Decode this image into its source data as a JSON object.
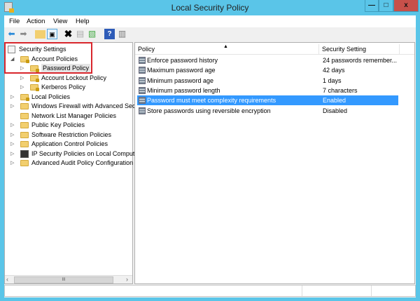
{
  "window": {
    "title": "Local Security Policy",
    "minimize": "—",
    "maximize": "□",
    "close": "x"
  },
  "menu": [
    "File",
    "Action",
    "View",
    "Help"
  ],
  "toolbar": [
    "back-icon",
    "forward-icon",
    "up-folder-icon",
    "show-hide-tree-icon",
    "delete-icon",
    "properties-icon",
    "export-list-icon",
    "help-icon",
    "show-action-pane-icon"
  ],
  "tree": [
    {
      "label": "Security Settings",
      "level": 0,
      "expander": "",
      "icon": "security-settings-icon"
    },
    {
      "label": "Account Policies",
      "level": 1,
      "expander": "◢",
      "icon": "folder-lock-icon"
    },
    {
      "label": "Password Policy",
      "level": 2,
      "expander": "▷",
      "icon": "folder-lock-icon",
      "selected": true
    },
    {
      "label": "Account Lockout Policy",
      "level": 2,
      "expander": "▷",
      "icon": "folder-lock-icon"
    },
    {
      "label": "Kerberos Policy",
      "level": 2,
      "expander": "▷",
      "icon": "folder-lock-icon"
    },
    {
      "label": "Local Policies",
      "level": 1,
      "expander": "▷",
      "icon": "folder-lock-icon"
    },
    {
      "label": "Windows Firewall with Advanced Secu",
      "level": 1,
      "expander": "▷",
      "icon": "folder-icon"
    },
    {
      "label": "Network List Manager Policies",
      "level": 1,
      "expander": "",
      "icon": "folder-icon"
    },
    {
      "label": "Public Key Policies",
      "level": 1,
      "expander": "▷",
      "icon": "folder-icon"
    },
    {
      "label": "Software Restriction Policies",
      "level": 1,
      "expander": "▷",
      "icon": "folder-icon"
    },
    {
      "label": "Application Control Policies",
      "level": 1,
      "expander": "▷",
      "icon": "folder-icon"
    },
    {
      "label": "IP Security Policies on Local Compute",
      "level": 1,
      "expander": "▷",
      "icon": "computer-icon"
    },
    {
      "label": "Advanced Audit Policy Configuration",
      "level": 1,
      "expander": "▷",
      "icon": "folder-icon"
    }
  ],
  "list": {
    "columns": [
      "Policy",
      "Security Setting"
    ],
    "sort_indicator": "▲",
    "rows": [
      {
        "policy": "Enforce password history",
        "setting": "24 passwords remember..."
      },
      {
        "policy": "Maximum password age",
        "setting": "42 days"
      },
      {
        "policy": "Minimum password age",
        "setting": "1 days"
      },
      {
        "policy": "Minimum password length",
        "setting": "7 characters"
      },
      {
        "policy": "Password must meet complexity requirements",
        "setting": "Enabled",
        "selected": true
      },
      {
        "policy": "Store passwords using reversible encryption",
        "setting": "Disabled"
      }
    ]
  },
  "scrollbar": {
    "left": "‹",
    "thumb": "III",
    "right": "›"
  },
  "colors": {
    "accent": "#5ac5e8",
    "selection": "#3399ff",
    "highlight_box": "#d8262c",
    "close": "#c7504a"
  }
}
